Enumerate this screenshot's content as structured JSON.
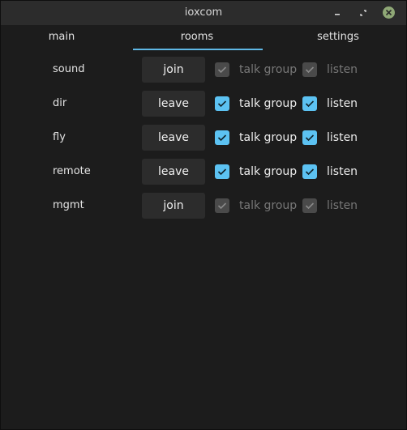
{
  "window": {
    "title": "ioxcom"
  },
  "tabs": [
    {
      "label": "main"
    },
    {
      "label": "rooms"
    },
    {
      "label": "settings"
    }
  ],
  "rooms": [
    {
      "name": "sound",
      "action": "join",
      "talk_group_label": "talk group",
      "listen_label": "listen",
      "talk_group_checked": true,
      "listen_checked": true,
      "enabled": false
    },
    {
      "name": "dir",
      "action": "leave",
      "talk_group_label": "talk group",
      "listen_label": "listen",
      "talk_group_checked": true,
      "listen_checked": true,
      "enabled": true
    },
    {
      "name": "fly",
      "action": "leave",
      "talk_group_label": "talk group",
      "listen_label": "listen",
      "talk_group_checked": true,
      "listen_checked": true,
      "enabled": true
    },
    {
      "name": "remote",
      "action": "leave",
      "talk_group_label": "talk group",
      "listen_label": "listen",
      "talk_group_checked": true,
      "listen_checked": true,
      "enabled": true
    },
    {
      "name": "mgmt",
      "action": "join",
      "talk_group_label": "talk group",
      "listen_label": "listen",
      "talk_group_checked": true,
      "listen_checked": true,
      "enabled": false
    }
  ],
  "colors": {
    "accent": "#5cc2f2",
    "tab_indicator": "#5fb8e6",
    "close_button": "#8fa876",
    "background": "#1c1c1c",
    "titlebar": "#2c2c2c"
  },
  "icons": {
    "minimize": "minimize-icon",
    "maximize": "maximize-icon",
    "close": "close-icon",
    "check": "checkmark-icon"
  }
}
